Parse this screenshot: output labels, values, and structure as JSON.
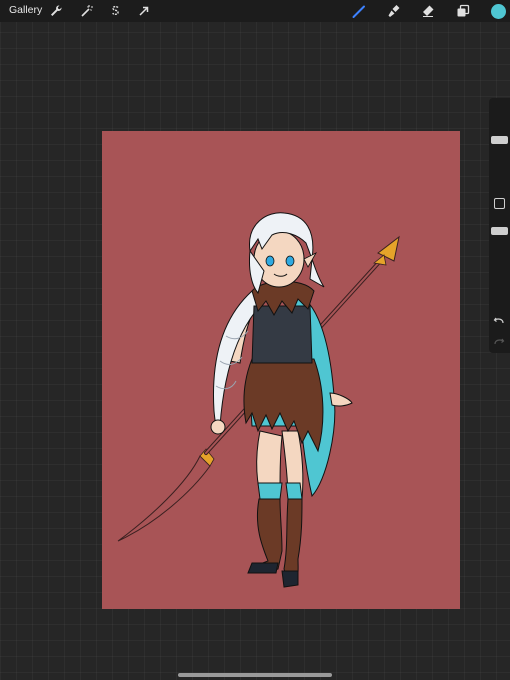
{
  "toolbar": {
    "gallery_label": "Gallery",
    "left_icons": [
      "wrench-icon",
      "magic-wand-icon",
      "selection-s-icon",
      "transform-arrow-icon"
    ],
    "right_icons": [
      "brush-icon",
      "smudge-icon",
      "eraser-icon",
      "layers-icon"
    ],
    "accent_color": "#3d82ff",
    "current_color": "#4fc6d2"
  },
  "sidebar": {
    "brush_size_level": 0.22,
    "brush_opacity_level": 0.48,
    "icons": [
      "modify-square-icon",
      "undo-icon",
      "redo-icon"
    ]
  },
  "canvas": {
    "background_color": "#a85456",
    "artwork": "character-with-spear"
  }
}
